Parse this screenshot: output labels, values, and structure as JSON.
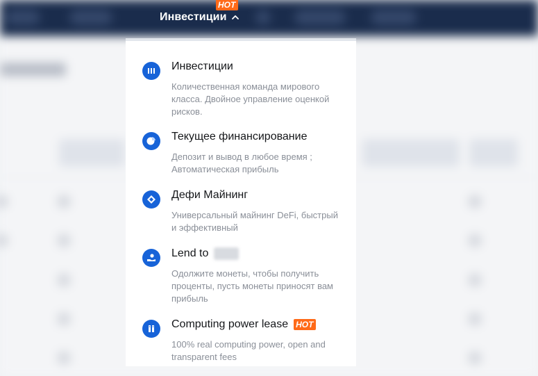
{
  "nav": {
    "active_label": "Инвестиции",
    "hot_badge": "HOT"
  },
  "menu": {
    "items": [
      {
        "title": "Инвестиции",
        "desc": "Количественная команда мирового класса. Двойное управление оценкой рисков.",
        "icon": "bank-icon"
      },
      {
        "title": "Текущее финансирование",
        "desc": "Депозит и вывод в любое время ; Автоматическая прибыль",
        "icon": "pie-chart-icon"
      },
      {
        "title": "Дефи Майнинг",
        "desc": "Универсальный майнинг DeFi, быстрый и эффективный",
        "icon": "diamond-icon"
      },
      {
        "title": "Lend to",
        "desc": "Одолжите монеты, чтобы получить проценты, пусть монеты приносят вам прибыль",
        "icon": "hand-coin-icon"
      },
      {
        "title": "Computing power lease",
        "badge": "HOT",
        "desc": "100% real computing power, open and transparent fees",
        "icon": "server-icon"
      }
    ]
  },
  "colors": {
    "topbar": "#1a2c4c",
    "accent": "#1763d8",
    "hot": "#ff6a18"
  }
}
